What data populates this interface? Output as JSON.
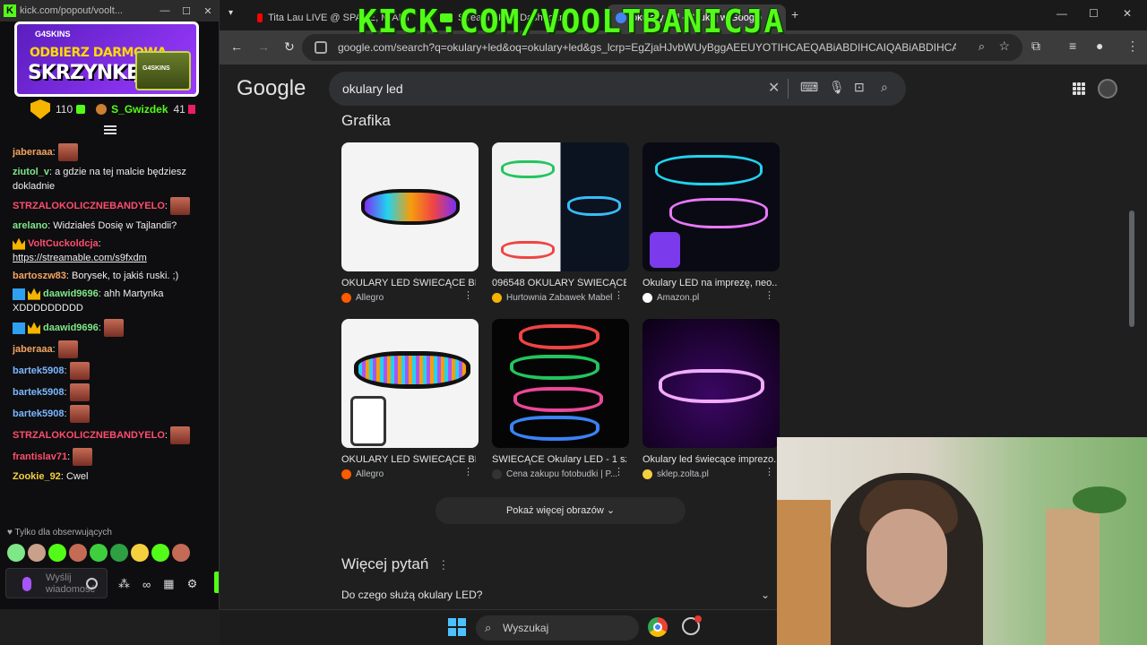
{
  "chat_window": {
    "url": "kick.com/popout/voolt...",
    "promo": {
      "brand": "G4SKINS",
      "line1": "ODBIERZ DARMOWĄ",
      "line2": "SKRZYNKĘ!"
    },
    "top_user": {
      "count": "110",
      "name": "S_Gwizdek",
      "count2": "41"
    },
    "messages": [
      {
        "user": "jaberaaa",
        "color": "#f4a460",
        "text": ""
      },
      {
        "user": "ziutol_v",
        "color": "#7ee787",
        "text": "a gdzie na tej malcie będziesz dokladnie"
      },
      {
        "user": "STRZALOKOLICZNEBANDYELO",
        "color": "#ff4d6d",
        "text": ""
      },
      {
        "user": "arelano",
        "color": "#7ee787",
        "text": "Widziałeś Dosię w Tajlandii?"
      },
      {
        "user": "VoltCuckoldcja",
        "color": "#ff4d6d",
        "text": "",
        "link": "https://streamable.com/s9fxdm"
      },
      {
        "user": "bartoszw83",
        "color": "#f4a460",
        "text": "Borysek, to jakiś ruski. ;)"
      },
      {
        "user": "daawid9696",
        "color": "#7ee787",
        "text": "ahh Martynka XDDDDDDDDD"
      },
      {
        "user": "daawid9696",
        "color": "#7ee787",
        "text": ""
      },
      {
        "user": "jaberaaa",
        "color": "#f4a460",
        "text": ""
      },
      {
        "user": "bartek5908",
        "color": "#7cb7ff",
        "text": ""
      },
      {
        "user": "bartek5908",
        "color": "#7cb7ff",
        "text": ""
      },
      {
        "user": "bartek5908",
        "color": "#7cb7ff",
        "text": ""
      },
      {
        "user": "STRZALOKOLICZNEBANDYELO",
        "color": "#ff4d6d",
        "text": ""
      },
      {
        "user": "frantislav71",
        "color": "#ff4d6d",
        "text": ""
      },
      {
        "user": "Zookie_92",
        "color": "#f4d03f",
        "text": "Cwel"
      }
    ],
    "followers_only": "Tylko dla obserwujących",
    "input_placeholder": "Wyślij wiadomość"
  },
  "browser": {
    "overlay_text": "KICK.COM/VOOLTBANICJA",
    "tabs": [
      {
        "label": "Tita Lau LIVE @ SPACE, MIAMI",
        "color": "#ff0000"
      },
      {
        "label": "Stream - Kick Dashboard",
        "color": "#53fc18"
      },
      {
        "label": "okulary led - Szukaj w Google",
        "color": "#4285f4"
      }
    ],
    "url": "google.com/search?q=okulary+led&oq=okulary+led&gs_lcrp=EgZjaHJvbWUyBggAEEUYOTIHCAEQABiABDIHCAIQABiABDIHCAMQA..."
  },
  "google": {
    "logo": "Google",
    "query": "okulary led",
    "section_title": "Grafika",
    "images": [
      {
        "caption": "OKULARY LED ŚWIECĄCE BL...",
        "source": "Allegro",
        "src_color": "#ff5a00"
      },
      {
        "caption": "096548 OKULARY ŚWIECĄCE...",
        "source": "Hurtownia Zabawek Mabel",
        "src_color": "#f4b400"
      },
      {
        "caption": "Okulary LED na imprezę, neo...",
        "source": "Amazon.pl",
        "src_color": "#ffffff"
      },
      {
        "caption": "OKULARY LED ŚWIECĄCE BL...",
        "source": "Allegro",
        "src_color": "#ff5a00"
      },
      {
        "caption": "ŚWIECĄCE Okulary LED - 1 sz...",
        "source": "Cena zakupu fotobudki | P...",
        "src_color": "#333333"
      },
      {
        "caption": "Okulary led świecące imprezo...",
        "source": "sklep.zolta.pl",
        "src_color": "#f4d03f"
      }
    ],
    "more_button": "Pokaż więcej obrazów",
    "faq_title": "Więcej pytań",
    "faq_question": "Do czego służą okulary LED?"
  },
  "taskbar": {
    "search_label": "Wyszukaj"
  }
}
